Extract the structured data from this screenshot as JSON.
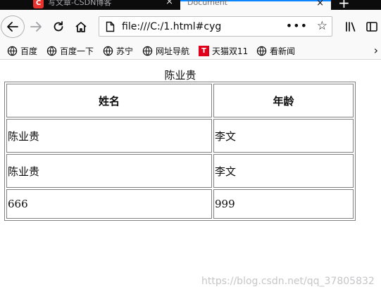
{
  "tabs": [
    {
      "title": "写文章-CSDN博客",
      "favicon": "C",
      "favicon_color": "#e8322d",
      "close": "×"
    },
    {
      "title": "Document",
      "close": "×"
    }
  ],
  "new_tab": "+",
  "navbar": {
    "url": "file:///C:/1.html#cyg",
    "page_actions": "•••",
    "bookmark_star": "☆"
  },
  "bookmarks": {
    "items": [
      {
        "label": "百度",
        "icon": "globe-icon"
      },
      {
        "label": "百度一下",
        "icon": "globe-icon"
      },
      {
        "label": "苏宁",
        "icon": "globe-icon"
      },
      {
        "label": "网址导航",
        "icon": "globe-icon"
      },
      {
        "label": "天猫双11",
        "icon": "tmall-icon",
        "icon_text": "T"
      },
      {
        "label": "看新闻",
        "icon": "globe-icon"
      }
    ],
    "more": "›"
  },
  "page": {
    "caption": "陈业贵",
    "headers": [
      "姓名",
      "年龄"
    ],
    "rows": [
      [
        "陈业贵",
        "李文"
      ],
      [
        "陈业贵",
        "李文"
      ],
      [
        "666",
        "999"
      ]
    ]
  },
  "watermark": "https://blog.csdn.net/qq_37805832",
  "colors": {
    "accent": "#0a84ff",
    "chrome": "#f9f9fa",
    "tabstrip": "#0c0c0d"
  }
}
